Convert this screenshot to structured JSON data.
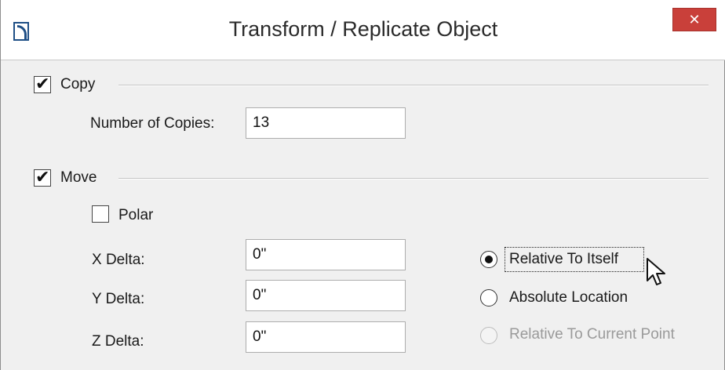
{
  "window": {
    "title": "Transform / Replicate Object",
    "close_label": "✕"
  },
  "copy": {
    "label": "Copy",
    "checked": true,
    "copies_label": "Number of Copies:",
    "copies_value": "13"
  },
  "move": {
    "label": "Move",
    "checked": true,
    "polar_label": "Polar",
    "polar_checked": false,
    "x_label": "X Delta:",
    "x_value": "0\"",
    "y_label": "Y Delta:",
    "y_value": "0\"",
    "z_label": "Z Delta:",
    "z_value": "0\""
  },
  "reference": {
    "options": [
      {
        "label": "Relative To Itself",
        "selected": true,
        "enabled": true
      },
      {
        "label": "Absolute Location",
        "selected": false,
        "enabled": true
      },
      {
        "label": "Relative To Current Point",
        "selected": false,
        "enabled": false
      }
    ]
  },
  "colors": {
    "close_button": "#c9403a",
    "icon_blue": "#1f4f86"
  }
}
